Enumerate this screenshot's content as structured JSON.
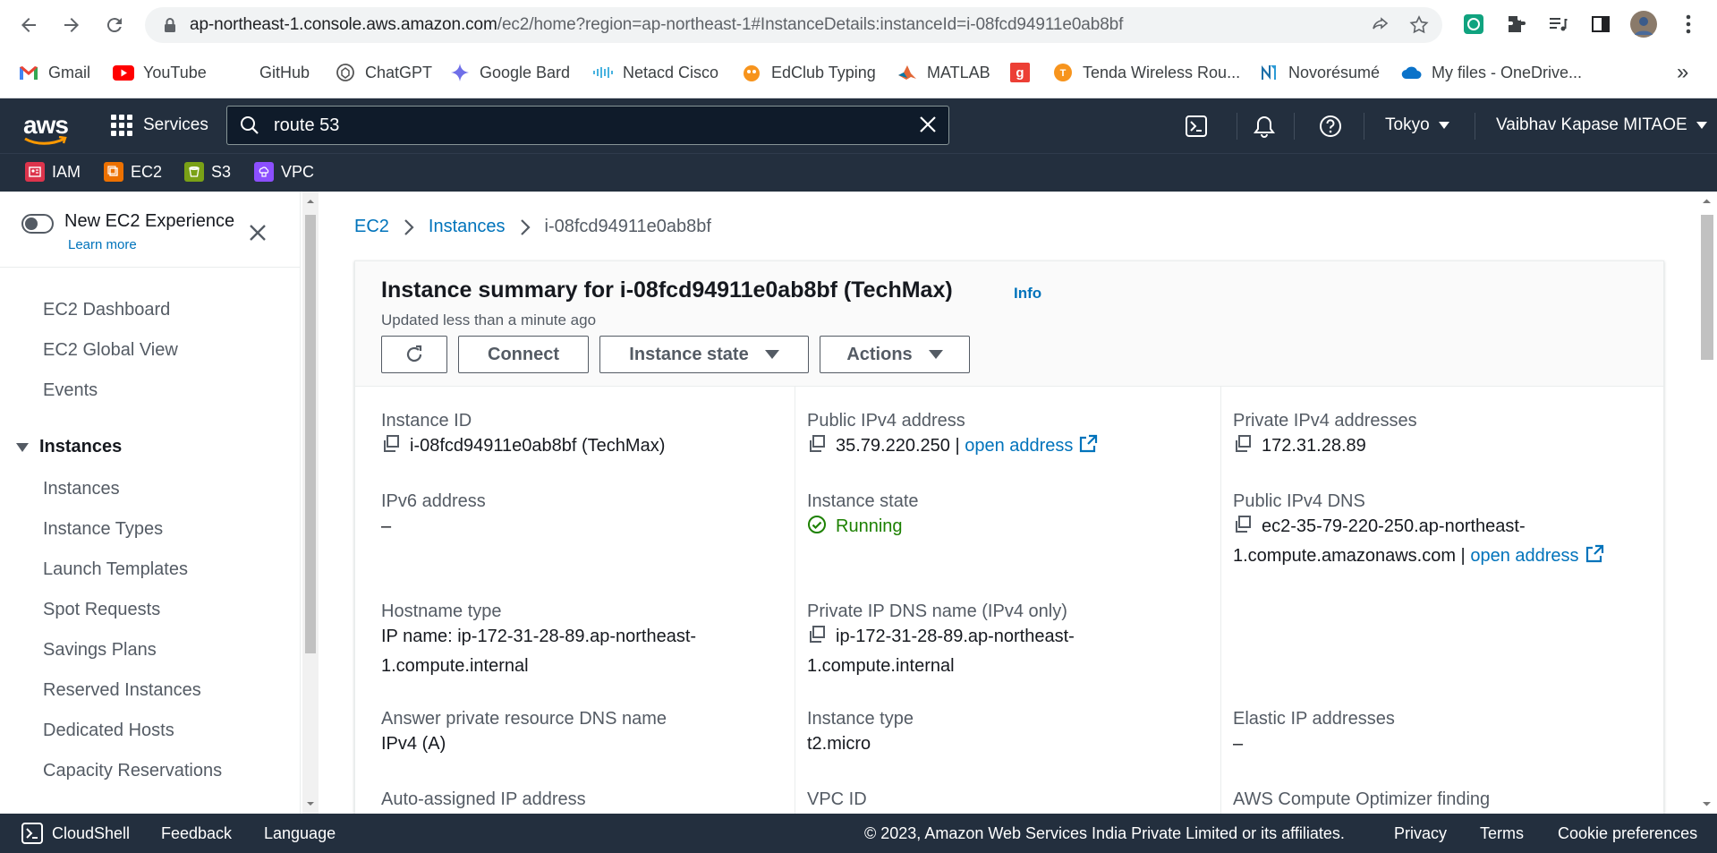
{
  "browser": {
    "url_domain": "ap-northeast-1.console.aws.amazon.com",
    "url_path": "/ec2/home?region=ap-northeast-1#InstanceDetails:instanceId=i-08fcd94911e0ab8bf",
    "bookmarks": [
      {
        "label": "Gmail",
        "icon": "gmail-icon"
      },
      {
        "label": "YouTube",
        "icon": "youtube-icon"
      },
      {
        "label": "GitHub",
        "icon": "github-icon"
      },
      {
        "label": "ChatGPT",
        "icon": "chatgpt-icon"
      },
      {
        "label": "Google Bard",
        "icon": "bard-icon"
      },
      {
        "label": "Netacd Cisco",
        "icon": "cisco-icon"
      },
      {
        "label": "EdClub Typing",
        "icon": "edclub-icon"
      },
      {
        "label": "MATLAB",
        "icon": "matlab-icon"
      },
      {
        "label": "",
        "icon": "g-icon"
      },
      {
        "label": "Tenda Wireless Rou...",
        "icon": "tenda-icon"
      },
      {
        "label": "Novorésumé",
        "icon": "novoresume-icon"
      },
      {
        "label": "My files - OneDrive...",
        "icon": "onedrive-icon"
      }
    ],
    "more": "»"
  },
  "aws_header": {
    "logo": "aws",
    "services": "Services",
    "search_value": "route 53",
    "region": "Tokyo",
    "account": "Vaibhav Kapase MITAOE"
  },
  "favorites": [
    {
      "label": "IAM",
      "color": "#dd344c"
    },
    {
      "label": "EC2",
      "color": "#ed7100"
    },
    {
      "label": "S3",
      "color": "#7aa116"
    },
    {
      "label": "VPC",
      "color": "#8c4fff"
    }
  ],
  "sidebar": {
    "new_experience": "New EC2 Experience",
    "learn_more": "Learn more",
    "top_items": [
      "EC2 Dashboard",
      "EC2 Global View",
      "Events"
    ],
    "section": "Instances",
    "section_items": [
      "Instances",
      "Instance Types",
      "Launch Templates",
      "Spot Requests",
      "Savings Plans",
      "Reserved Instances",
      "Dedicated Hosts",
      "Capacity Reservations"
    ]
  },
  "breadcrumb": {
    "root": "EC2",
    "parent": "Instances",
    "current": "i-08fcd94911e0ab8bf"
  },
  "summary": {
    "title": "Instance summary for i-08fcd94911e0ab8bf (TechMax)",
    "info": "Info",
    "updated": "Updated less than a minute ago",
    "connect": "Connect",
    "instance_state_btn": "Instance state",
    "actions": "Actions"
  },
  "details": {
    "instance_id_label": "Instance ID",
    "instance_id_value": "i-08fcd94911e0ab8bf (TechMax)",
    "public_ipv4_label": "Public IPv4 address",
    "public_ipv4_value": "35.79.220.250 |",
    "open_address": "open address",
    "private_ipv4_label": "Private IPv4 addresses",
    "private_ipv4_value": "172.31.28.89",
    "ipv6_label": "IPv6 address",
    "ipv6_value": "–",
    "instance_state_label": "Instance state",
    "instance_state_value": "Running",
    "public_dns_label": "Public IPv4 DNS",
    "public_dns_value_1": "ec2-35-79-220-250.ap-northeast-",
    "public_dns_value_2": "1.compute.amazonaws.com |",
    "hostname_type_label": "Hostname type",
    "hostname_type_value_1": "IP name: ip-172-31-28-89.ap-northeast-",
    "hostname_type_value_2": "1.compute.internal",
    "private_dns_label": "Private IP DNS name (IPv4 only)",
    "private_dns_value_1": "ip-172-31-28-89.ap-northeast-",
    "private_dns_value_2": "1.compute.internal",
    "answer_dns_label": "Answer private resource DNS name",
    "answer_dns_value": "IPv4 (A)",
    "instance_type_label": "Instance type",
    "instance_type_value": "t2.micro",
    "elastic_ip_label": "Elastic IP addresses",
    "elastic_ip_value": "–",
    "auto_ip_label": "Auto-assigned IP address",
    "vpc_id_label": "VPC ID",
    "optimizer_label": "AWS Compute Optimizer finding"
  },
  "footer": {
    "cloudshell": "CloudShell",
    "feedback": "Feedback",
    "language": "Language",
    "copyright": "© 2023, Amazon Web Services India Private Limited or its affiliates.",
    "privacy": "Privacy",
    "terms": "Terms",
    "cookies": "Cookie preferences"
  }
}
